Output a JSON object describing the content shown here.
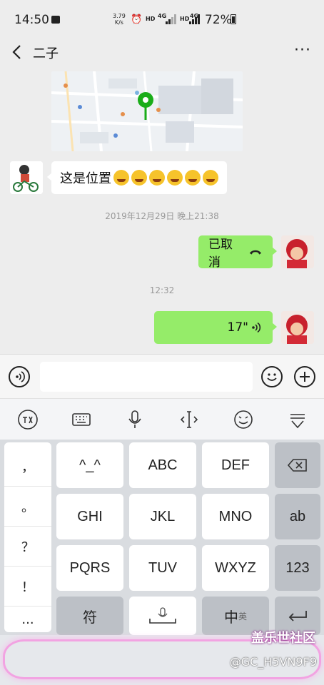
{
  "status": {
    "time": "14:50",
    "speed_value": "3.79",
    "speed_unit": "K/s",
    "hd1": "HD",
    "net1": "4G",
    "hd2": "HD",
    "net2": "4G",
    "battery": "72%"
  },
  "header": {
    "title": "二子",
    "more": "···"
  },
  "chat": {
    "messages": [
      {
        "side": "left",
        "type": "map"
      },
      {
        "side": "left",
        "type": "text",
        "text": "这是位置"
      },
      {
        "type": "timestamp",
        "text": "2019年12月29日 晚上21:38"
      },
      {
        "side": "right",
        "type": "call",
        "text": "已取消"
      },
      {
        "type": "timestamp",
        "text": "12:32"
      },
      {
        "side": "right",
        "type": "voice",
        "text": "17\""
      }
    ],
    "emoji_count": 6
  },
  "input": {
    "placeholder": ""
  },
  "ime_toolbar": [
    "logo-icon",
    "keyboard-icon",
    "mic-icon",
    "cursor-icon",
    "emoji-icon",
    "collapse-icon"
  ],
  "keyboard": {
    "symbols": [
      "，",
      "。",
      "？",
      "！",
      "..."
    ],
    "row1": [
      "^_^",
      "ABC",
      "DEF"
    ],
    "row2": [
      "GHI",
      "JKL",
      "MNO"
    ],
    "row3": [
      "PQRS",
      "TUV",
      "WXYZ"
    ],
    "ab": "ab",
    "num": "123",
    "fu": "符",
    "zhong": "中",
    "ying": "英"
  },
  "watermark": "@GC_H5VN9F9",
  "brand": "盖乐世社区"
}
